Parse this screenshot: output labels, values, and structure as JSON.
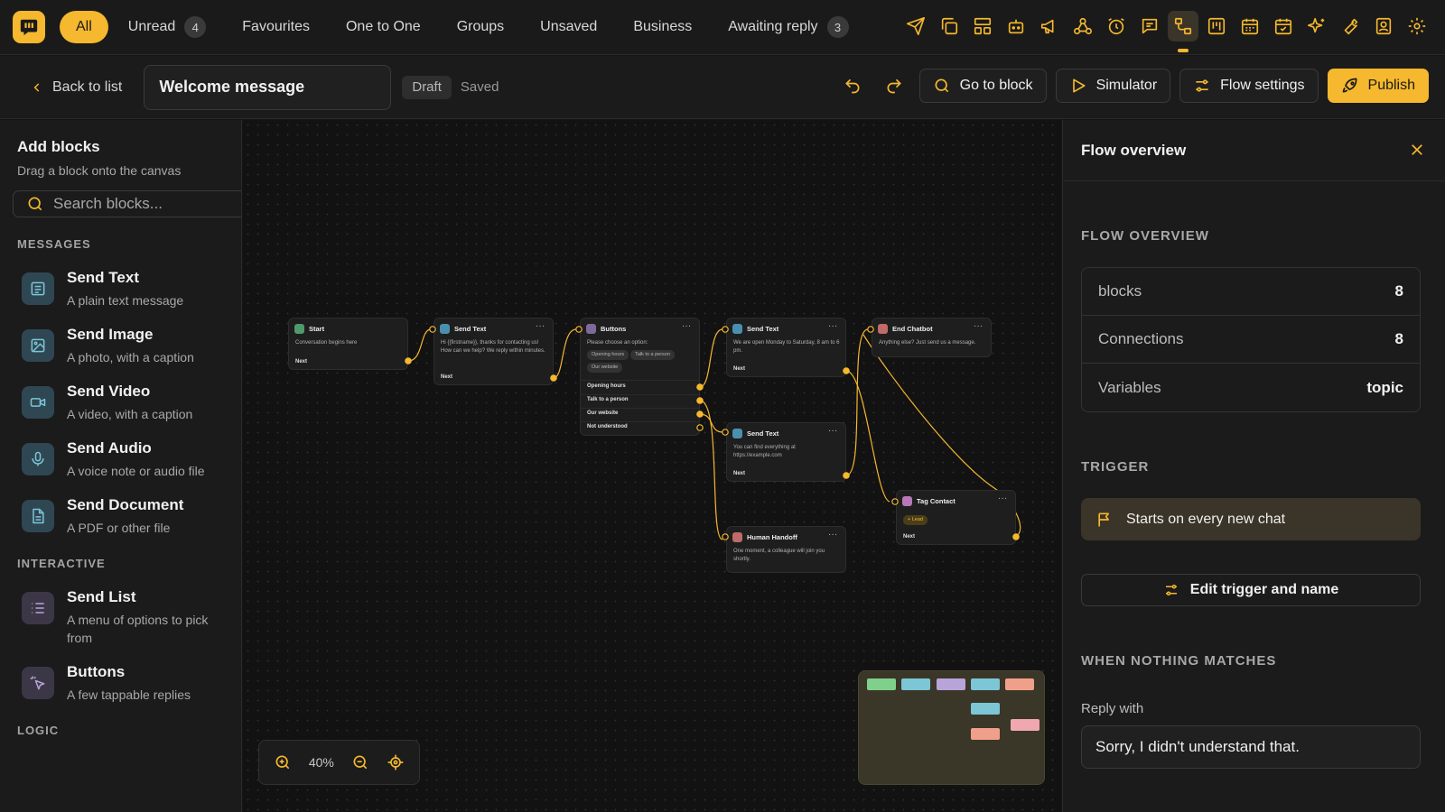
{
  "topbar": {
    "filters": [
      {
        "label": "All",
        "count": null,
        "active": true
      },
      {
        "label": "Unread",
        "count": "4"
      },
      {
        "label": "Favourites",
        "count": null
      },
      {
        "label": "One to One",
        "count": null
      },
      {
        "label": "Groups",
        "count": null
      },
      {
        "label": "Unsaved",
        "count": null
      },
      {
        "label": "Business",
        "count": null
      },
      {
        "label": "Awaiting reply",
        "count": "3"
      }
    ],
    "icons": [
      "send-icon",
      "copy-icon",
      "layout-icon",
      "bot-icon",
      "megaphone-icon",
      "webhook-icon",
      "alarm-icon",
      "chat-icon",
      "flow-icon",
      "kanban-icon",
      "calendar-icon",
      "calendar-check-icon",
      "sparkles-icon",
      "wrench-icon",
      "contact-icon",
      "gear-icon"
    ],
    "active_icon": "flow-icon"
  },
  "subbar": {
    "back_label": "Back to list",
    "flow_name": "Welcome message",
    "draft_label": "Draft",
    "saved_label": "Saved",
    "goto_label": "Go to block",
    "simulator_label": "Simulator",
    "settings_label": "Flow settings",
    "publish_label": "Publish"
  },
  "left": {
    "title": "Add blocks",
    "subtitle": "Drag a block onto the canvas",
    "search_placeholder": "Search blocks...",
    "sections": {
      "messages": "MESSAGES",
      "interactive": "INTERACTIVE",
      "logic": "LOGIC"
    },
    "messages": [
      {
        "title": "Send Text",
        "desc": "A plain text message",
        "icon": "text-icon"
      },
      {
        "title": "Send Image",
        "desc": "A photo, with a caption",
        "icon": "image-icon"
      },
      {
        "title": "Send Video",
        "desc": "A video, with a caption",
        "icon": "video-icon"
      },
      {
        "title": "Send Audio",
        "desc": "A voice note or audio file",
        "icon": "mic-icon"
      },
      {
        "title": "Send Document",
        "desc": "A PDF or other file",
        "icon": "document-icon"
      }
    ],
    "interactive": [
      {
        "title": "Send List",
        "desc": "A menu of options to pick from",
        "icon": "list-icon"
      },
      {
        "title": "Buttons",
        "desc": "A few tappable replies",
        "icon": "pointer-icon"
      }
    ]
  },
  "canvas": {
    "zoom": "40%",
    "nodes": {
      "start": {
        "title": "Start",
        "body": "Conversation begins here",
        "foot": "Next"
      },
      "text1": {
        "title": "Send Text",
        "body": "Hi {{firstname}}, thanks for contacting us! How can we help? We reply within minutes.",
        "foot": "Next"
      },
      "buttons": {
        "title": "Buttons",
        "body": "Please choose an option:",
        "pills": [
          "Opening hours",
          "Talk to a person",
          "Our website"
        ],
        "options": [
          "Opening hours",
          "Talk to a person",
          "Our website",
          "Not understood"
        ]
      },
      "text2": {
        "title": "Send Text",
        "body": "We are open Monday to Saturday, 8 am to 6 pm.",
        "foot": "Next"
      },
      "text3": {
        "title": "Send Text",
        "body": "You can find everything at https://example.com",
        "foot": "Next"
      },
      "handoff": {
        "title": "Human Handoff",
        "body": "One moment, a colleague will join you shortly."
      },
      "end": {
        "title": "End Chatbot",
        "body": "Anything else? Just send us a message."
      },
      "tag": {
        "title": "Tag Contact",
        "tag": "+ Lead",
        "foot": "Next"
      }
    },
    "node_more": "···",
    "colors": {
      "edge": "#f5b82e",
      "text": "#4a8fb0",
      "buttons": "#7d6a9a",
      "start": "#4f9a6a",
      "end": "#c06a6a",
      "handoff": "#c06a6a",
      "tag": "#b878b8"
    },
    "minimap_colors": [
      "#7fd08a",
      "#7cc6d6",
      "#b8a4d8",
      "#7cc6d6",
      "#f0a08a",
      "#7cc6d6",
      "#f0a08a",
      "#f0a8b0"
    ]
  },
  "right": {
    "title": "Flow overview",
    "overview_section": "FLOW OVERVIEW",
    "stats": [
      {
        "key": "blocks",
        "value": "8"
      },
      {
        "key": "Connections",
        "value": "8"
      },
      {
        "key": "Variables",
        "value": "topic"
      }
    ],
    "trigger_section": "TRIGGER",
    "trigger_text": "Starts on every new chat",
    "edit_trigger_label": "Edit trigger and name",
    "nothing_section": "WHEN NOTHING MATCHES",
    "reply_label": "Reply with",
    "reply_value": "Sorry, I didn't understand that."
  }
}
